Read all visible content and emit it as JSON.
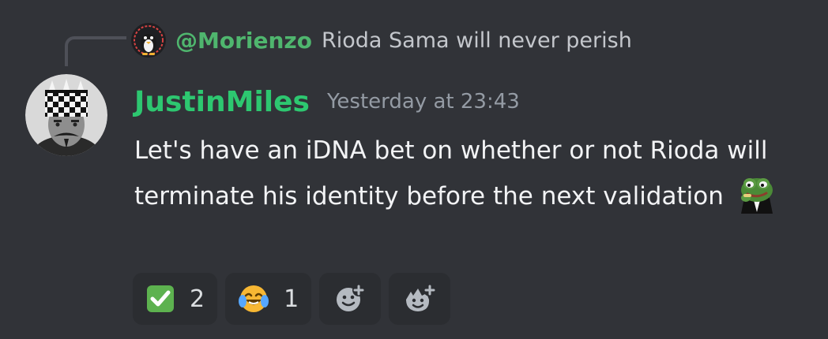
{
  "reply": {
    "username": "@Morienzo",
    "text": "Rioda Sama will never perish"
  },
  "message": {
    "username": "JustinMiles",
    "timestamp": "Yesterday at 23:43",
    "text": "Let's have an iDNA bet on whether or not Rioda will terminate his identity before the next validation",
    "emoji": "pepe-emoji",
    "username_color": "#2dc770"
  },
  "reactions": [
    {
      "icon": "checkmark-emoji",
      "count": "2"
    },
    {
      "icon": "crying-laughing-emoji",
      "count": "1"
    }
  ],
  "actions": {
    "add_reaction_icon": "add-reaction-icon",
    "add_super_reaction_icon": "add-super-reaction-icon"
  },
  "colors": {
    "background": "#313338",
    "reaction_background": "#2b2d31",
    "reply_username": "#4fb66e"
  }
}
